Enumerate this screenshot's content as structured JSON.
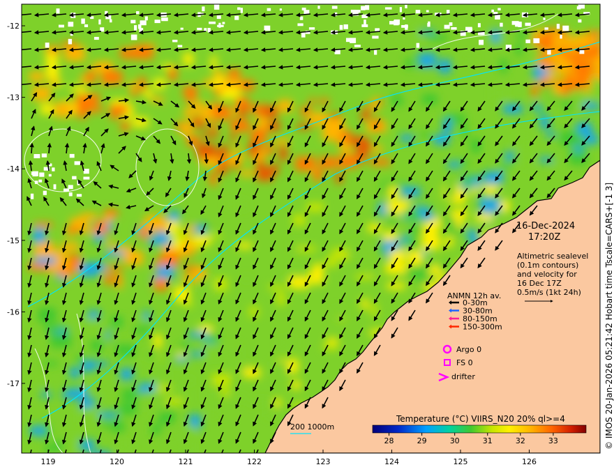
{
  "map": {
    "date": "16-Dec-2024",
    "time": "17:20Z",
    "altimetry_lines": [
      "Altimetric sealevel",
      "(0.1m contours)",
      "and velocity for",
      "16 Dec 17Z",
      "0.5m/s (1kt 24h)"
    ],
    "side_caption": "© IMOS 20-Jan-2026 05:21:42 Hobart time Tscale=CARS+[-1 3]",
    "x_ticks": [
      "119",
      "120",
      "121",
      "122",
      "123",
      "124",
      "125",
      "126"
    ],
    "y_ticks": [
      "-12",
      "-13",
      "-14",
      "-15",
      "-16",
      "-17"
    ]
  },
  "anmn": {
    "title": "ANMN 12h av.",
    "items": [
      {
        "label": "0-30m",
        "color": "#000000"
      },
      {
        "label": "30-80m",
        "color": "#1e64ff"
      },
      {
        "label": "80-150m",
        "color": "#ff1e96"
      },
      {
        "label": "150-300m",
        "color": "#ff2800"
      }
    ]
  },
  "symbols": {
    "argo": "Argo 0",
    "fs": "FS 0",
    "drifter": "drifter",
    "color": "#ff00ff"
  },
  "bathy_legend": {
    "label": "200  1000m",
    "color": "#00e5ff"
  },
  "colorbar": {
    "title": "Temperature (°C) VIIRS_N20 20% ql>=4",
    "ticks": [
      "28",
      "29",
      "30",
      "31",
      "32",
      "33"
    ],
    "range": [
      27.5,
      34
    ]
  },
  "colors": {
    "land": "#fbc8a0",
    "cloud": "#ffffff",
    "contour": "#ffffff",
    "bathy": "#00e5ff"
  }
}
